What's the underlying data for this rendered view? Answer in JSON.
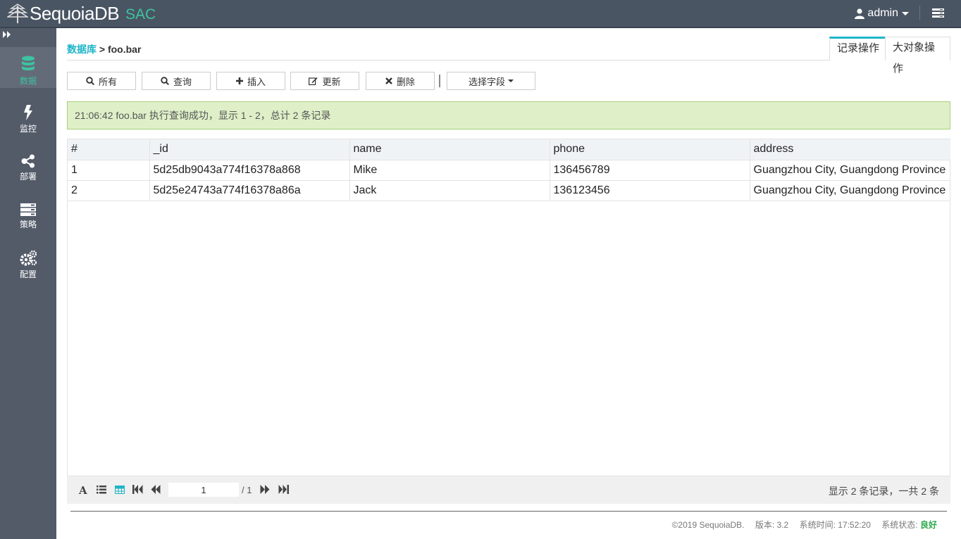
{
  "app": {
    "brand": "SequoiaDB",
    "product": "SAC"
  },
  "header": {
    "user": "admin"
  },
  "sidebar": {
    "items": [
      {
        "label": "数据",
        "icon": "database-icon",
        "active": true
      },
      {
        "label": "监控",
        "icon": "bolt-icon"
      },
      {
        "label": "部署",
        "icon": "share-icon"
      },
      {
        "label": "策略",
        "icon": "server-icon"
      },
      {
        "label": "配置",
        "icon": "gears-icon"
      }
    ]
  },
  "breadcrumb": {
    "root": "数据库",
    "separator": ">",
    "current": "foo.bar"
  },
  "tabs": [
    {
      "label": "记录操作",
      "active": true
    },
    {
      "label": "大对象操作"
    }
  ],
  "toolbar": {
    "all": "所有",
    "query": "查询",
    "insert": "插入",
    "update": "更新",
    "delete": "删除",
    "fields": "选择字段"
  },
  "alert": {
    "message": "21:06:42 foo.bar 执行查询成功，显示 1 - 2，总计 2 条记录"
  },
  "table": {
    "columns": [
      "#",
      "_id",
      "name",
      "phone",
      "address"
    ],
    "rows": [
      [
        "1",
        "5d25db9043a774f16378a868",
        "Mike",
        "136456789",
        "Guangzhou City, Guangdong Province"
      ],
      [
        "2",
        "5d25e24743a774f16378a86a",
        "Jack",
        "136123456",
        "Guangzhou City, Guangdong Province"
      ]
    ]
  },
  "pager": {
    "current_page": "1",
    "total_pages": "/ 1",
    "info": "显示 2 条记录，一共 2 条"
  },
  "footer": {
    "copyright": "©2019 SequoiaDB.",
    "version": "版本: 3.2",
    "system_time": "系统时间: 17:52:20",
    "status_label": "系统状态:",
    "status_value": "良好"
  },
  "colors": {
    "accent": "#1fb5c7",
    "brand_green": "#3cc3a0",
    "topbar": "#4a5563",
    "sidebar": "#535b69",
    "success_bg": "#dff0c8",
    "status_good": "#2aa84a"
  }
}
